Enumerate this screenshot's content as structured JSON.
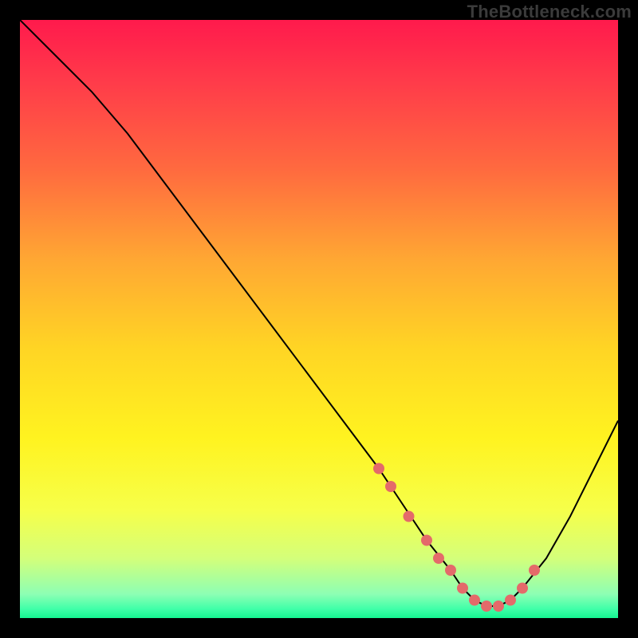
{
  "watermark": "TheBottleneck.com",
  "colors": {
    "background": "#000000",
    "curve_stroke": "#000000",
    "marker_fill": "#e46a6a",
    "gradient_stops": [
      {
        "offset": 0.0,
        "color": "#ff1a4c"
      },
      {
        "offset": 0.1,
        "color": "#ff3a4a"
      },
      {
        "offset": 0.25,
        "color": "#ff6a3f"
      },
      {
        "offset": 0.4,
        "color": "#ffa733"
      },
      {
        "offset": 0.55,
        "color": "#ffd524"
      },
      {
        "offset": 0.7,
        "color": "#fff320"
      },
      {
        "offset": 0.82,
        "color": "#f6ff4a"
      },
      {
        "offset": 0.9,
        "color": "#d4ff7a"
      },
      {
        "offset": 0.96,
        "color": "#8dffb4"
      },
      {
        "offset": 0.985,
        "color": "#3fffa8"
      },
      {
        "offset": 1.0,
        "color": "#14f591"
      }
    ]
  },
  "chart_data": {
    "type": "line",
    "title": "",
    "xlabel": "",
    "ylabel": "",
    "xlim": [
      0,
      100
    ],
    "ylim": [
      0,
      100
    ],
    "x": [
      0,
      4,
      8,
      12,
      18,
      24,
      30,
      36,
      42,
      48,
      54,
      60,
      64,
      68,
      72,
      74,
      76,
      78,
      80,
      82,
      84,
      88,
      92,
      96,
      100
    ],
    "y": [
      100,
      96,
      92,
      88,
      81,
      73,
      65,
      57,
      49,
      41,
      33,
      25,
      19,
      13,
      8,
      5,
      3,
      2,
      2,
      3,
      5,
      10,
      17,
      25,
      33
    ],
    "markers": {
      "description": "salmon dots near valley",
      "x": [
        60,
        62,
        65,
        68,
        70,
        72,
        74,
        76,
        78,
        80,
        82,
        84,
        86
      ],
      "y": [
        25,
        22,
        17,
        13,
        10,
        8,
        5,
        3,
        2,
        2,
        3,
        5,
        8
      ]
    }
  }
}
